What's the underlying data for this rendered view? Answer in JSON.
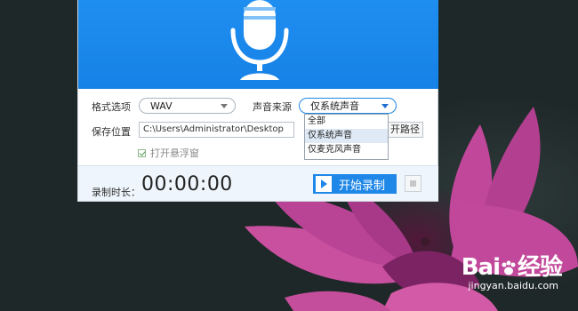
{
  "form": {
    "format_label": "格式选项",
    "format_value": "WAV",
    "source_label": "声音来源",
    "source_value": "仅系统声音",
    "save_label": "保存位置",
    "save_path": "C:\\Users\\Administrator\\Desktop",
    "open_path_label": "开路径",
    "float_window_label": "打开悬浮窗"
  },
  "dropdown": {
    "options": [
      "全部",
      "仅系统声音",
      "仅麦克风声音"
    ],
    "selected_index": 1
  },
  "footer": {
    "duration_label": "录制时长：",
    "timer": "00:00:00",
    "start_label": "开始录制"
  },
  "watermark": {
    "logo_text_a": "Bai",
    "logo_text_b": "经验",
    "url": "jingyan.baidu.com"
  },
  "colors": {
    "header_blue": "#1f8ef1",
    "button_blue": "#1f87e8",
    "footer_bg": "#eef5fc"
  }
}
